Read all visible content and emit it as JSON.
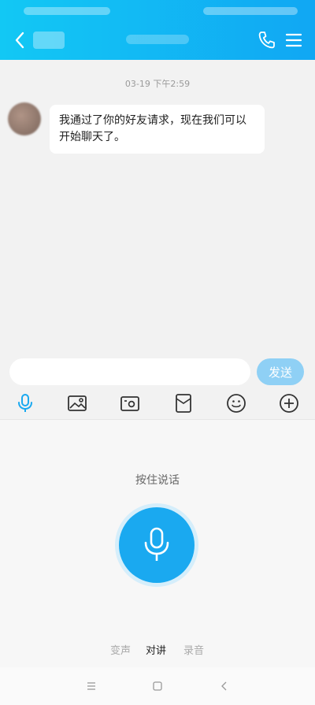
{
  "header": {
    "back_icon": "chevron-left-icon",
    "phone_icon": "phone-icon",
    "menu_icon": "hamburger-menu-icon"
  },
  "chat": {
    "timestamp": "03-19 下午2:59",
    "messages": [
      {
        "text": "我通过了你的好友请求，现在我们可以开始聊天了。"
      }
    ]
  },
  "input": {
    "value": "",
    "send_label": "发送"
  },
  "toolbar": {
    "icons": [
      "microphone-icon",
      "image-icon",
      "camera-icon",
      "red-packet-icon",
      "emoji-icon",
      "plus-icon"
    ]
  },
  "voice": {
    "hold_label": "按住说话",
    "modes": [
      "变声",
      "对讲",
      "录音"
    ],
    "active_mode": "对讲"
  },
  "navbar": {
    "icons": [
      "menu-icon",
      "home-icon",
      "back-icon"
    ]
  },
  "colors": {
    "accent": "#1aa9f0",
    "header_start": "#12c8f4",
    "header_end": "#11a7f3",
    "send_disabled": "#8fd0f5"
  }
}
